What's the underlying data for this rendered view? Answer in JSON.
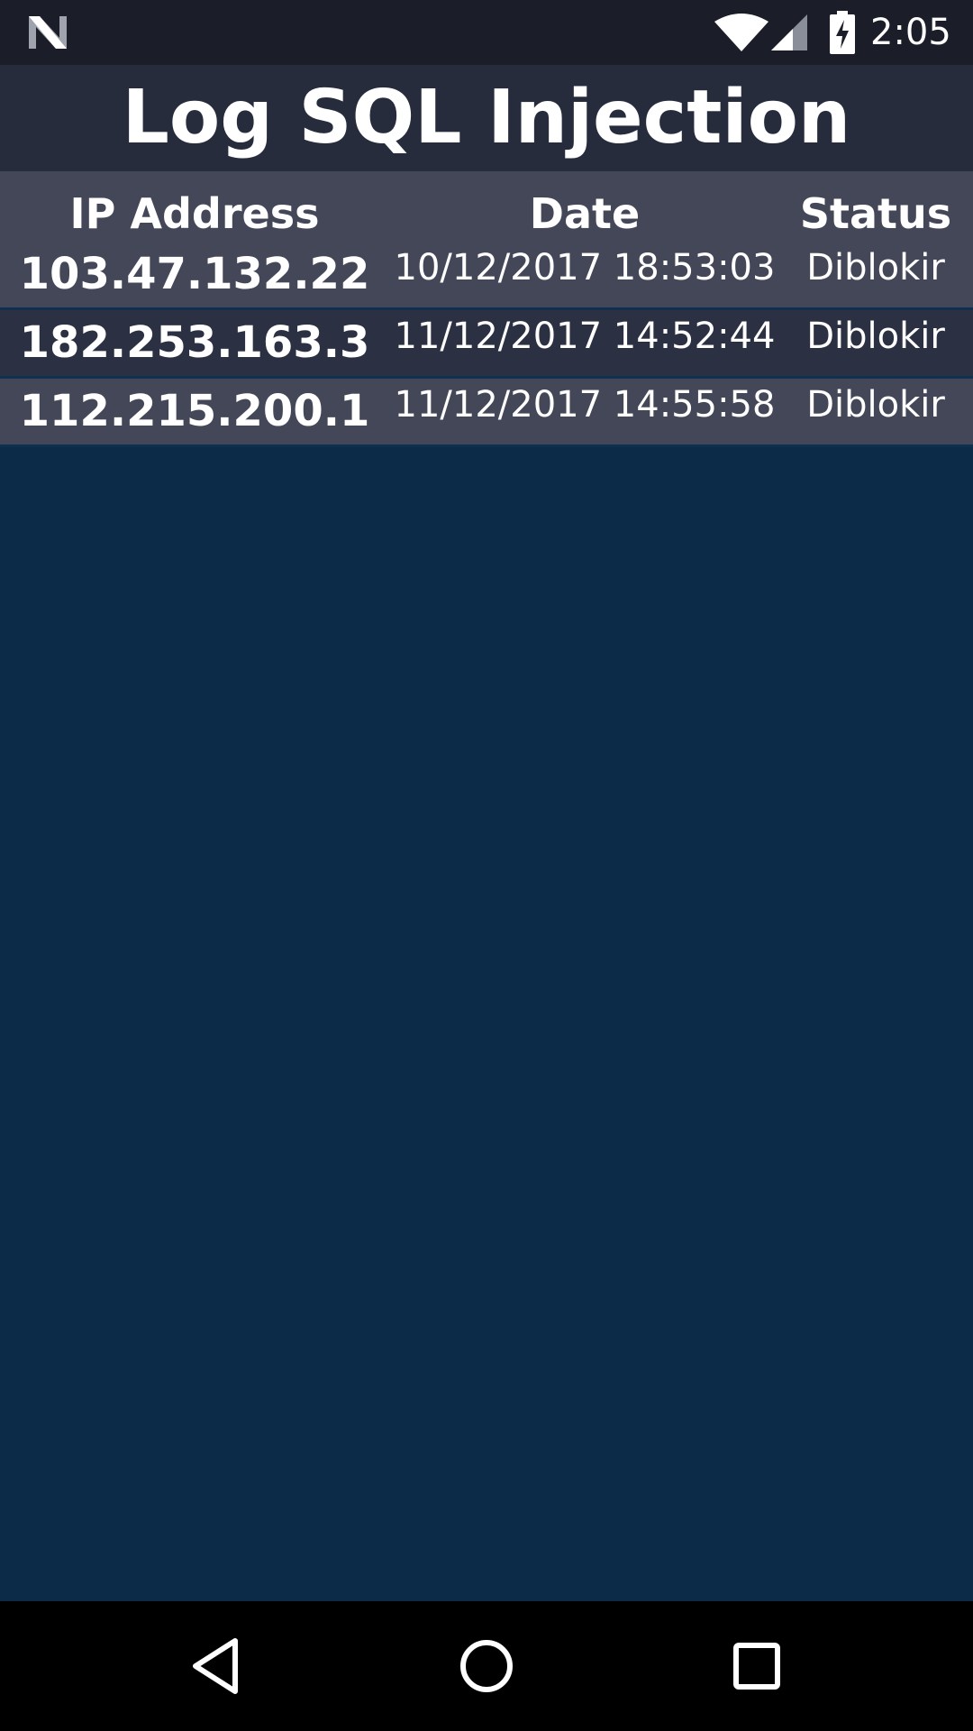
{
  "status_bar": {
    "time": "2:05",
    "icons": [
      "n-logo-icon",
      "wifi-icon",
      "cell-signal-icon",
      "battery-charging-icon"
    ]
  },
  "title": "Log SQL Injection",
  "table": {
    "headers": {
      "ip": "IP Address",
      "date": "Date",
      "status": "Status"
    },
    "rows": [
      {
        "ip": "103.47.132.22",
        "date": "10/12/2017 18:53:03",
        "status": "Diblokir"
      },
      {
        "ip": "182.253.163.3",
        "date": "11/12/2017 14:52:44",
        "status": "Diblokir"
      },
      {
        "ip": "112.215.200.1",
        "date": "11/12/2017 14:55:58",
        "status": "Diblokir"
      }
    ]
  },
  "nav_bar": {
    "icons": [
      "back-icon",
      "home-icon",
      "recents-icon"
    ]
  },
  "colors": {
    "background": "#0c2b48",
    "status_bar": "#1b1e29",
    "title_bar": "#272c3d",
    "row_light": "#444758",
    "row_dark": "#2c3043",
    "nav_bar": "#000000",
    "text": "#ffffff"
  }
}
